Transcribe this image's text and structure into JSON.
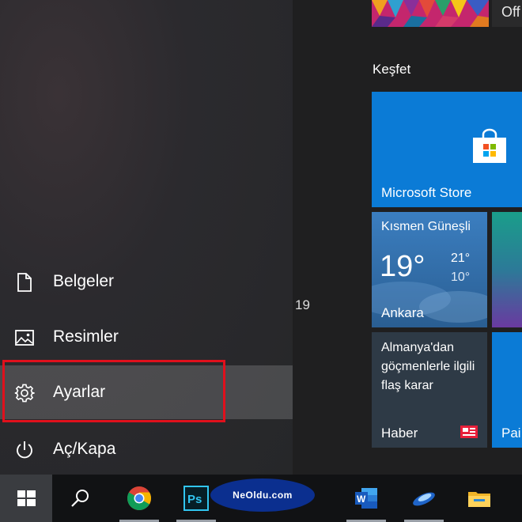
{
  "start_menu": {
    "items": [
      {
        "label": "Belgeler",
        "icon": "document-icon"
      },
      {
        "label": "Resimler",
        "icon": "pictures-icon"
      },
      {
        "label": "Ayarlar",
        "icon": "gear-icon"
      },
      {
        "label": "Aç/Kapa",
        "icon": "power-icon"
      }
    ],
    "stray_text": "19"
  },
  "tiles": {
    "office_partial": "Off",
    "group_label": "Keşfet",
    "store": {
      "label": "Microsoft Store"
    },
    "weather": {
      "condition": "Kısmen Güneşli",
      "temp": "19°",
      "high": "21°",
      "low": "10°",
      "city": "Ankara"
    },
    "news": {
      "headline": "Almanya'dan göçmenlerle ilgili flaş karar",
      "source": "Haber"
    },
    "paint_partial": "Pai"
  },
  "watermark": {
    "text": "NeOldu.com"
  },
  "taskbar": {
    "items": [
      "windows-start-icon",
      "search-icon",
      "chrome-icon",
      "photoshop-icon",
      "word-icon",
      "app-icon",
      "file-explorer-icon"
    ],
    "photoshop_text": "Ps",
    "word_text": "W"
  },
  "colors": {
    "accent_blue": "#0b7bd6",
    "highlight_red": "#e0101c",
    "weather_blue": "#2c6aa5",
    "taskbar": "#111214"
  }
}
